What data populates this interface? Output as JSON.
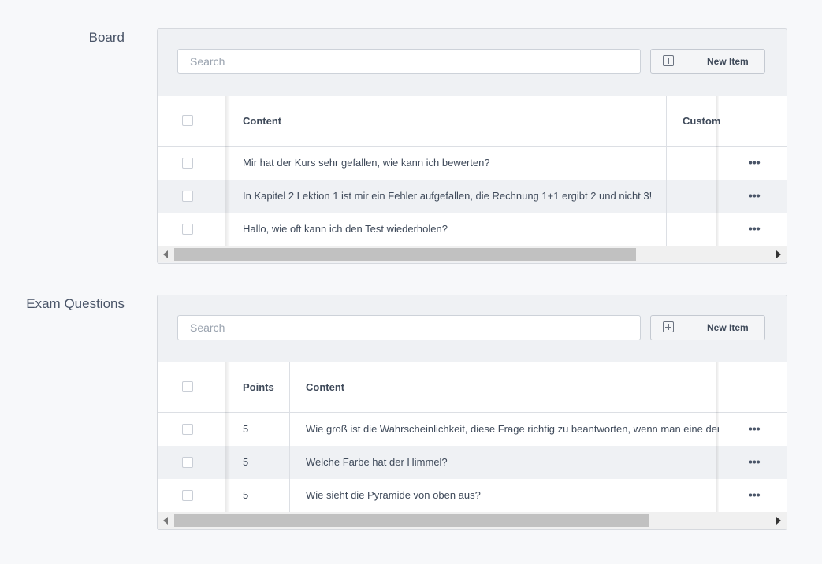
{
  "board": {
    "label": "Board",
    "search_placeholder": "Search",
    "new_item_label": "New Item",
    "columns": [
      "Content",
      "Custom"
    ],
    "rows": [
      {
        "content": "Mir hat der Kurs sehr gefallen, wie kann ich bewerten?"
      },
      {
        "content": "In Kapitel 2 Lektion 1 ist mir ein Fehler aufgefallen, die Rechnung 1+1 ergibt 2 und nicht 3!"
      },
      {
        "content": "Hallo, wie oft kann ich den Test wiederholen?"
      }
    ],
    "row_action": "•••"
  },
  "exam": {
    "label": "Exam Questions",
    "search_placeholder": "Search",
    "new_item_label": "New Item",
    "columns": [
      "Points",
      "Content"
    ],
    "rows": [
      {
        "points": "5",
        "content": "Wie groß ist die Wahrscheinlichkeit, diese Frage richtig zu beantworten, wenn man eine der"
      },
      {
        "points": "5",
        "content": "Welche Farbe hat der Himmel?"
      },
      {
        "points": "5",
        "content": "Wie sieht die Pyramide von oben aus?"
      }
    ],
    "row_action": "•••"
  }
}
